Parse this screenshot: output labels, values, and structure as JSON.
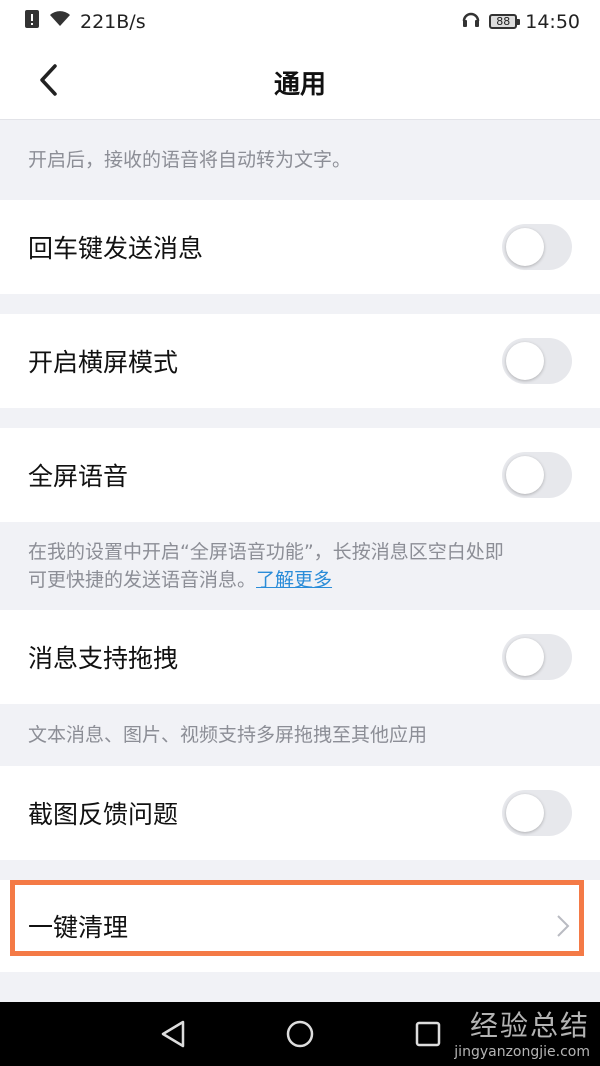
{
  "status": {
    "speed": "221B/s",
    "battery": "88",
    "time": "14:50"
  },
  "header": {
    "title": "通用"
  },
  "notes": {
    "voice_to_text": "开启后，接收的语音将自动转为文字。",
    "fullscreen_voice_a": "在我的设置中开启“全屏语音功能”，长按消息区空白处即",
    "fullscreen_voice_b": "可更快捷的发送语音消息。",
    "learn_more": "了解更多",
    "drag": "文本消息、图片、视频支持多屏拖拽至其他应用"
  },
  "settings": [
    {
      "label": "回车键发送消息",
      "enabled": false
    },
    {
      "label": "开启横屏模式",
      "enabled": false
    },
    {
      "label": "全屏语音",
      "enabled": false
    },
    {
      "label": "消息支持拖拽",
      "enabled": false
    },
    {
      "label": "截图反馈问题",
      "enabled": false
    }
  ],
  "one_click_clean": {
    "label": "一键清理"
  },
  "watermark": {
    "line1": "经验总结",
    "line2": "jingyanzongjie.com"
  },
  "colors": {
    "accent_highlight": "#f47a46",
    "link": "#2a8cd8",
    "toggle_off": "#e7e8ec"
  }
}
